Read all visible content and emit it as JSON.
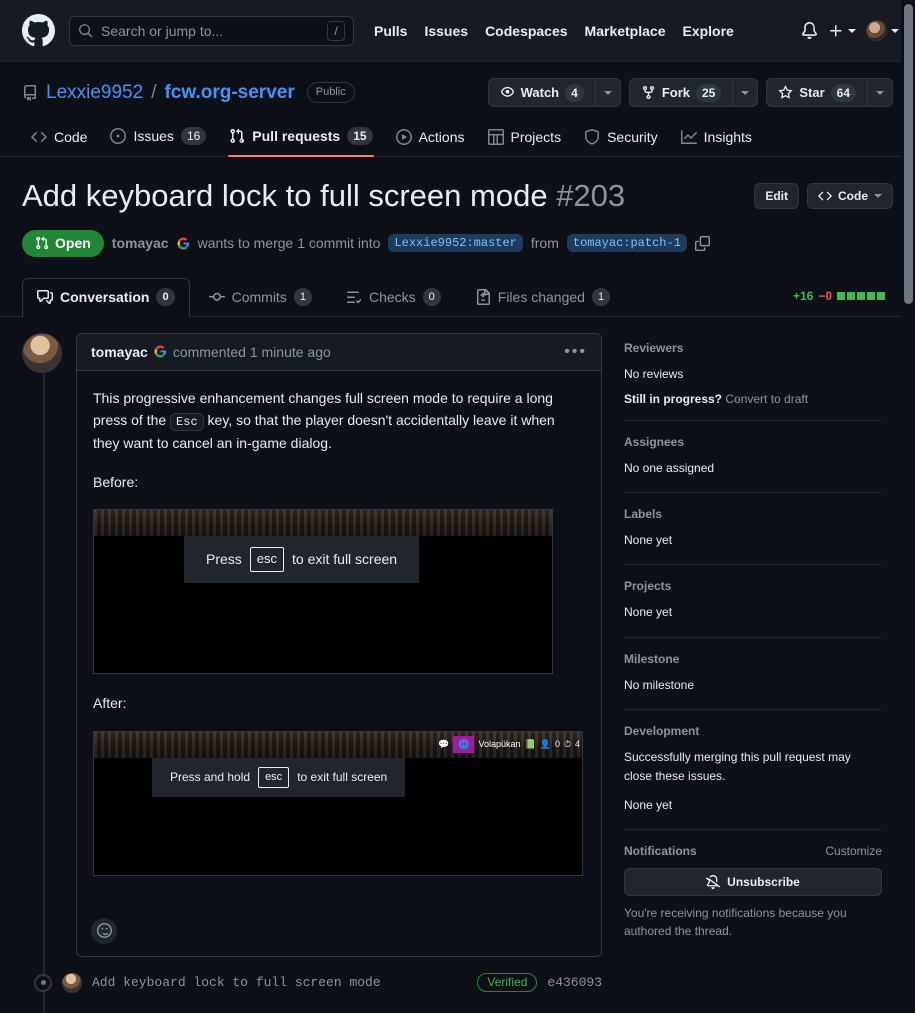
{
  "header": {
    "logo_icon": "github-mark-icon",
    "search": {
      "placeholder": "Search or jump to...",
      "shortcut": "/",
      "icon": "search-icon"
    },
    "nav": [
      {
        "label": "Pulls"
      },
      {
        "label": "Issues"
      },
      {
        "label": "Codespaces"
      },
      {
        "label": "Marketplace"
      },
      {
        "label": "Explore"
      }
    ],
    "notifications_icon": "bell-icon",
    "create_icon": "plus-icon",
    "avatar_icon": "user-avatar"
  },
  "repo": {
    "icon": "repo-icon",
    "owner": "Lexxie9952",
    "separator": "/",
    "name": "fcw.org-server",
    "visibility": "Public",
    "actions": [
      {
        "label": "Watch",
        "count": "4",
        "icon": "eye-icon"
      },
      {
        "label": "Fork",
        "count": "25",
        "icon": "fork-icon"
      },
      {
        "label": "Star",
        "count": "64",
        "icon": "star-icon"
      }
    ],
    "tabs": [
      {
        "label": "Code",
        "icon": "code-icon",
        "count": ""
      },
      {
        "label": "Issues",
        "icon": "issue-opened-icon",
        "count": "16"
      },
      {
        "label": "Pull requests",
        "icon": "git-pull-request-icon",
        "count": "15",
        "selected": true
      },
      {
        "label": "Actions",
        "icon": "play-icon",
        "count": ""
      },
      {
        "label": "Projects",
        "icon": "table-icon",
        "count": ""
      },
      {
        "label": "Security",
        "icon": "shield-icon",
        "count": ""
      },
      {
        "label": "Insights",
        "icon": "graph-icon",
        "count": ""
      }
    ]
  },
  "pull_request": {
    "title": "Add keyboard lock to full screen mode",
    "number": "#203",
    "edit_label": "Edit",
    "code_label": "Code",
    "state": "Open",
    "state_icon": "git-pull-request-icon",
    "author": "tomayac",
    "author_badge_icon": "google-logo-icon",
    "merge_text_1": "wants to merge 1 commit into",
    "base_branch": "Lexxie9952:master",
    "merge_text_2": "from",
    "head_branch": "tomayac:patch-1",
    "copy_icon": "copy-icon",
    "tabs": [
      {
        "label": "Conversation",
        "count": "0",
        "icon": "comment-discussion-icon",
        "selected": true
      },
      {
        "label": "Commits",
        "count": "1",
        "icon": "git-commit-icon",
        "selected": false
      },
      {
        "label": "Checks",
        "count": "0",
        "icon": "checklist-icon",
        "selected": false
      },
      {
        "label": "Files changed",
        "count": "1",
        "icon": "file-diff-icon",
        "selected": false
      }
    ],
    "diffstat": {
      "additions": "+16",
      "deletions": "−0",
      "squares": 5
    }
  },
  "comment": {
    "author": "tomayac",
    "author_badge_icon": "google-logo-icon",
    "action": "commented 1 minute ago",
    "menu_icon": "kebab-horizontal-icon",
    "paragraph_1a": "This progressive enhancement changes full screen mode to require a long press of the",
    "inline_code": "Esc",
    "paragraph_1b": "key, so that the player doesn't accidentally leave it when they want to cancel an in-game dialog.",
    "before_label": "Before:",
    "after_label": "After:",
    "before_image": {
      "alt": "fullscreen-exit-prompt-before",
      "banner_prefix": "Press",
      "banner_key": "esc",
      "banner_suffix": "to exit full screen"
    },
    "after_image": {
      "alt": "fullscreen-exit-prompt-after",
      "banner_prefix": "Press and hold",
      "banner_key": "esc",
      "banner_suffix": "to exit full screen",
      "hud_chat_icon": "chat-bubble-icon",
      "hud_nation_icon": "nation-flag-icon",
      "hud_player": "Volapükan",
      "hud_research_icon": "research-icon",
      "hud_pop_icon": "population-icon",
      "hud_pop_value": "0",
      "hud_clock_icon": "clock-icon",
      "hud_clock_value": "4"
    },
    "reaction_icon": "smiley-icon"
  },
  "commit": {
    "avatar_icon": "user-avatar",
    "message": "Add keyboard lock to full screen mode",
    "verified": "Verified",
    "sha": "e436093"
  },
  "sidebar": {
    "sections": [
      {
        "title": "Reviewers",
        "value": "No reviews",
        "sub_bold": "Still in progress?",
        "sub_link": "Convert to draft"
      },
      {
        "title": "Assignees",
        "value": "No one assigned"
      },
      {
        "title": "Labels",
        "value": "None yet"
      },
      {
        "title": "Projects",
        "value": "None yet"
      },
      {
        "title": "Milestone",
        "value": "No milestone"
      },
      {
        "title": "Development",
        "value": "Successfully merging this pull request may close these issues.",
        "value2": "None yet"
      }
    ],
    "notifications": {
      "title": "Notifications",
      "customize": "Customize",
      "button_label": "Unsubscribe",
      "button_icon": "bell-slash-icon",
      "note": "You're receiving notifications because you authored the thread."
    }
  },
  "colors": {
    "bg": "#0d1117",
    "surface": "#161b22",
    "border": "#30363d",
    "accent_blue": "#4493f8",
    "green": "#238636",
    "add_green": "#3fb950",
    "del_red": "#f85149",
    "tab_underline": "#f78166"
  }
}
